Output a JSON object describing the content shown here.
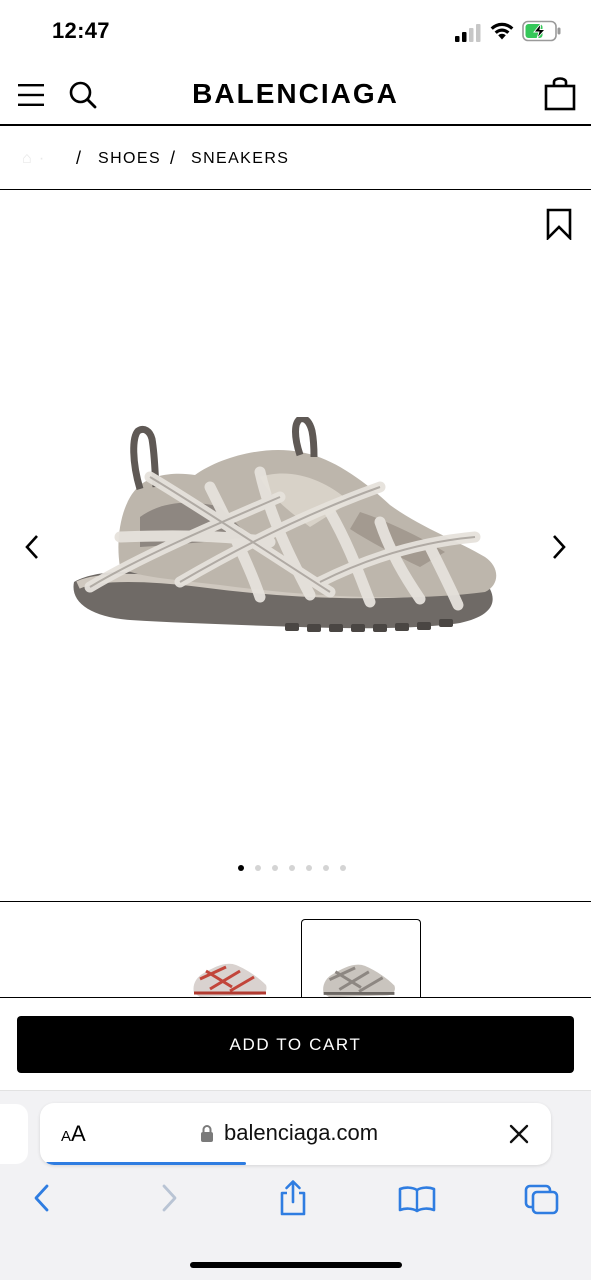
{
  "status_bar": {
    "time": "12:47"
  },
  "header": {
    "brand": "BALENCIAGA"
  },
  "breadcrumb": {
    "items": [
      "SHOES",
      "SNEAKERS"
    ],
    "separator": "/"
  },
  "carousel": {
    "dot_count": 7,
    "active_index": 0
  },
  "thumbnails": [
    {
      "name": "red-sneaker-thumb",
      "selected": false
    },
    {
      "name": "grey-sneaker-thumb",
      "selected": true
    }
  ],
  "actions": {
    "add_to_cart": "ADD TO CART"
  },
  "browser": {
    "text_size_small": "A",
    "text_size_large": "A",
    "url": "balenciaga.com",
    "load_progress": 0.4,
    "accent": "#2f7de1"
  },
  "icons": [
    "hamburger-icon",
    "search-icon",
    "shopping-bag-icon",
    "bookmark-icon",
    "chevron-left-icon",
    "chevron-right-icon",
    "lock-icon",
    "close-icon",
    "share-icon",
    "book-icon",
    "tabs-icon"
  ]
}
